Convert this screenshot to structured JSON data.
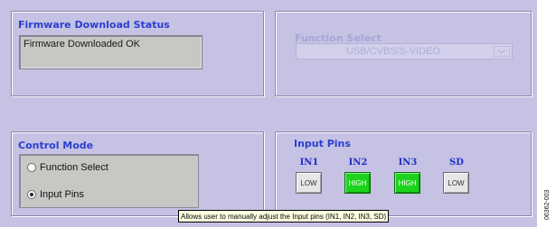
{
  "firmware": {
    "title": "Firmware Download Status",
    "status": "Firmware Downloaded OK"
  },
  "function_select": {
    "title": "Function Select",
    "selected": "USB/CVBS/S-VIDEO",
    "enabled": false
  },
  "control_mode": {
    "title": "Control Mode",
    "options": [
      {
        "label": "Function Select",
        "selected": false
      },
      {
        "label": "Input Pins",
        "selected": true
      }
    ]
  },
  "input_pins": {
    "title": "Input Pins",
    "pins": [
      {
        "name": "IN1",
        "state": "LOW"
      },
      {
        "name": "IN2",
        "state": "HIGH"
      },
      {
        "name": "IN3",
        "state": "HIGH"
      },
      {
        "name": "SD",
        "state": "LOW"
      }
    ]
  },
  "tooltip": "Allows user to manually adjust the Input pins (IN1, IN2, IN3, SD)",
  "figure_code": "06362-003",
  "colors": {
    "panel_bg": "#c5c2e4",
    "title_blue": "#2a3fd0",
    "high_green": "#1cd21c",
    "low_gray": "#e6e6e6",
    "tooltip_bg": "#ffffe1"
  }
}
